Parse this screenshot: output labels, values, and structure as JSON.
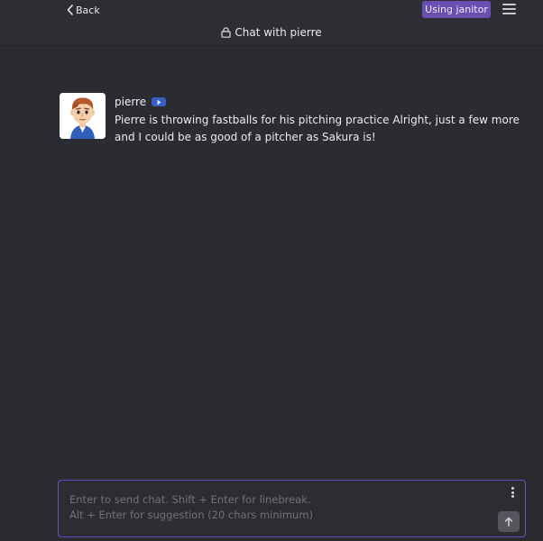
{
  "header": {
    "back_label": "Back",
    "model_badge": "Using janitor",
    "chat_title": "Chat with pierre",
    "icons": {
      "back": "chevron-left-icon",
      "menu": "hamburger-menu-icon",
      "title": "lock-icon"
    }
  },
  "messages": [
    {
      "sender": "pierre",
      "badge_icon": "bot-badge-icon",
      "avatar_icon": "character-avatar",
      "text": "Pierre is throwing fastballs for his pitching practice Alright, just a few more and I could be as good of a pitcher as Sakura is!"
    }
  ],
  "composer": {
    "placeholder_line1": "Enter to send chat. Shift + Enter for linebreak.",
    "placeholder_line2": "Alt + Enter for suggestion (20 chars minimum)",
    "icons": {
      "options": "kebab-menu-icon",
      "send": "arrow-up-icon"
    }
  },
  "colors": {
    "background": "#2b2c32",
    "accent": "#6b4fb0",
    "composer_border": "#6a4fc0",
    "bot_badge": "#3b5fc5"
  }
}
